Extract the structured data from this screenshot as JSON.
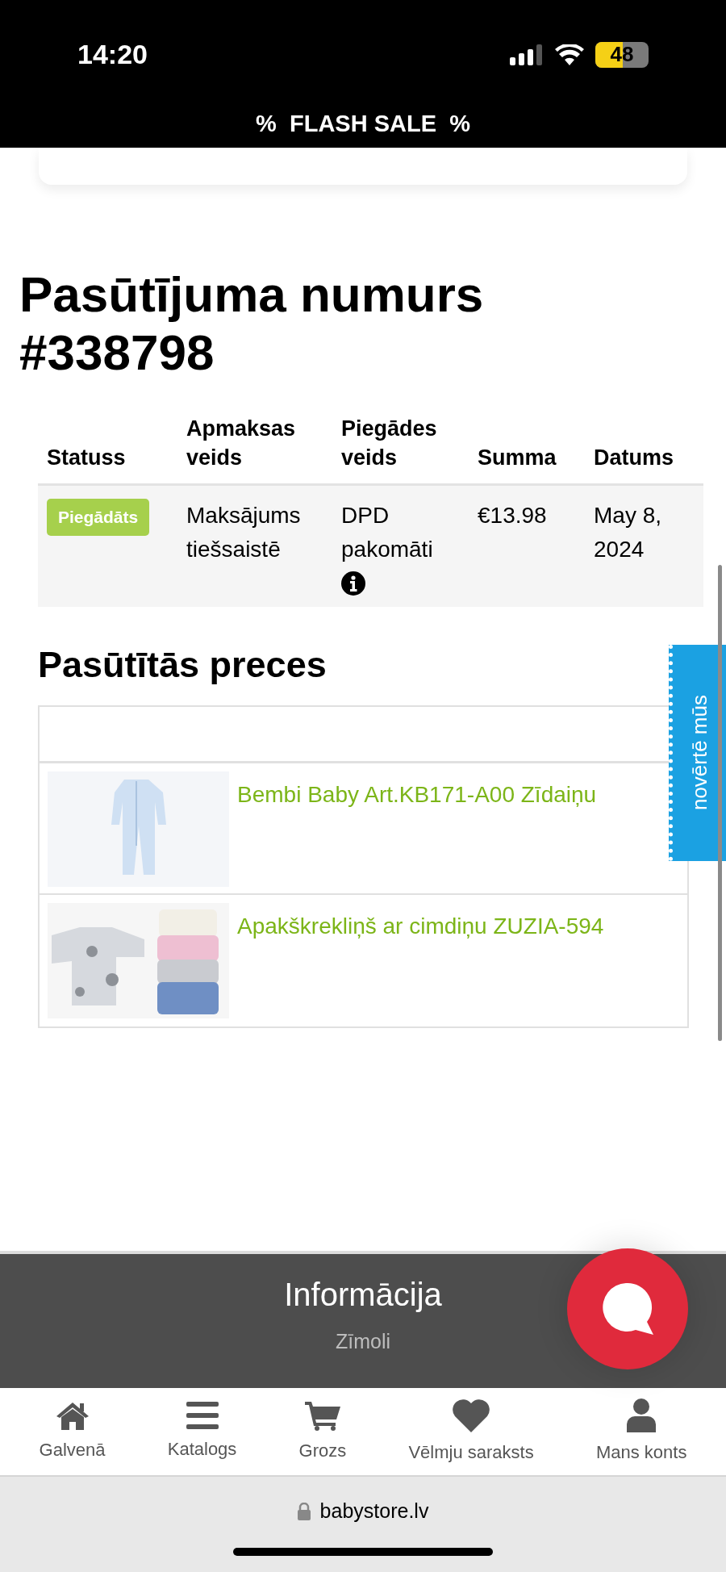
{
  "status_bar": {
    "time": "14:20",
    "battery": "48"
  },
  "promo_banner": {
    "text": "%  FLASH SALE  %"
  },
  "order": {
    "title": "Pasūtījuma numurs #338798",
    "columns": [
      "Statuss",
      "Apmaksas veids",
      "Piegādes veids",
      "Summa",
      "Datums"
    ],
    "rows": [
      {
        "status": "Piegādāts",
        "payment": "Maksājums tiešsaistē",
        "delivery": "DPD pakomāti",
        "delivery_info": true,
        "sum": "€13.98",
        "date": "May 8, 2024"
      }
    ]
  },
  "products": {
    "title": "Pasūtītās preces",
    "items": [
      {
        "name": "Bembi Baby Art.KB171-A00 Zīdaiņu"
      },
      {
        "name": "Apakškrekliņš ar cimdiņu ZUZIA-594"
      }
    ]
  },
  "rating_tab": {
    "label": "novērtē mūs"
  },
  "footer": {
    "title": "Informācija",
    "links": [
      "Zīmoli"
    ]
  },
  "bottom_nav": [
    {
      "label": "Galvenā"
    },
    {
      "label": "Katalogs"
    },
    {
      "label": "Grozs"
    },
    {
      "label": "Vēlmju saraksts"
    },
    {
      "label": "Mans konts"
    }
  ],
  "browser": {
    "url": "babystore.lv"
  }
}
